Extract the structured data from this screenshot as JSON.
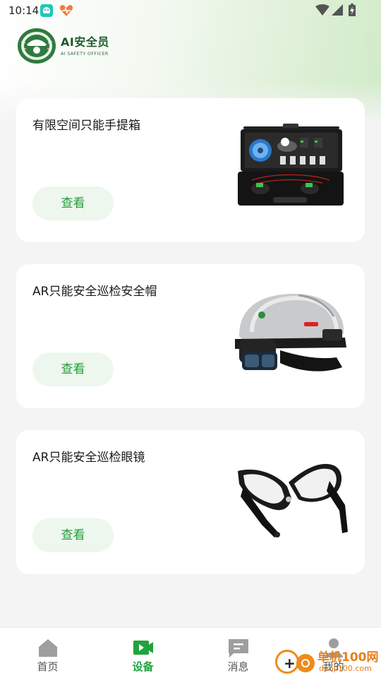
{
  "status_bar": {
    "time": "10:14",
    "icons": [
      "app-notification-icon",
      "heart-app-icon",
      "wifi-icon",
      "signal-icon",
      "battery-charging-icon"
    ]
  },
  "brand": {
    "title": "AI安全员",
    "subtitle": "AI SAFETY OFFICER",
    "logo": "safety-emblem-logo"
  },
  "cards": [
    {
      "title": "有限空间只能手提箱",
      "button_label": "查看",
      "image": "toolbox-case-image"
    },
    {
      "title": "AR只能安全巡检安全帽",
      "button_label": "查看",
      "image": "ar-helmet-image"
    },
    {
      "title": "AR只能安全巡检眼镜",
      "button_label": "查看",
      "image": "ar-glasses-image"
    }
  ],
  "nav": {
    "items": [
      {
        "label": "首页",
        "icon": "home-icon",
        "active": false
      },
      {
        "label": "设备",
        "icon": "video-device-icon",
        "active": true
      },
      {
        "label": "消息",
        "icon": "message-icon",
        "active": false
      },
      {
        "label": "我的",
        "icon": "profile-icon",
        "active": false
      }
    ]
  },
  "watermark": {
    "text": "单机100网",
    "url": "danji100.com"
  },
  "colors": {
    "accent": "#21a33e",
    "button_bg": "#edf7ed",
    "brand_green": "#1e5a2e",
    "watermark_orange": "#f08a1c"
  }
}
